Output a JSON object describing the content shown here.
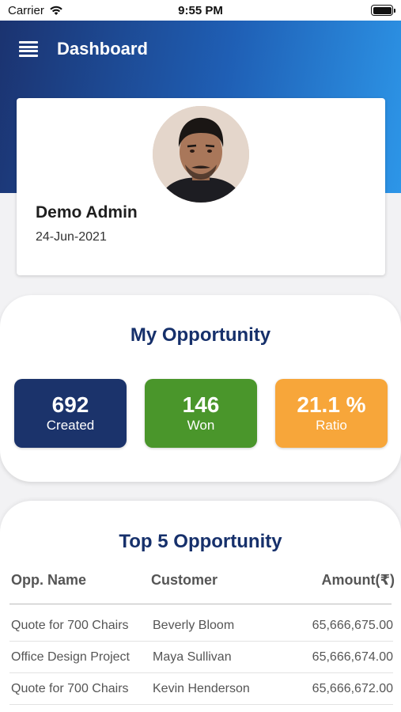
{
  "status_bar": {
    "carrier": "Carrier",
    "time": "9:55 PM",
    "wifi_icon": "wifi-icon",
    "battery_icon": "battery-icon"
  },
  "header": {
    "title": "Dashboard",
    "menu_icon": "hamburger-menu-icon"
  },
  "profile": {
    "name": "Demo Admin",
    "date": "24-Jun-2021",
    "avatar_icon": "avatar"
  },
  "my_opportunity": {
    "title": "My Opportunity",
    "stats": [
      {
        "value": "692",
        "label": "Created",
        "color": "#1b336b"
      },
      {
        "value": "146",
        "label": "Won",
        "color": "#4a962b"
      },
      {
        "value": "21.1 %",
        "label": "Ratio",
        "color": "#f7a63a"
      }
    ]
  },
  "top_opportunity": {
    "title": "Top 5 Opportunity",
    "columns": [
      "Opp. Name",
      "Customer",
      "Amount(₹)"
    ],
    "rows": [
      {
        "name": "Quote for 700 Chairs",
        "customer": "Beverly Bloom",
        "amount": "65,666,675.00"
      },
      {
        "name": "Office Design Project",
        "customer": "Maya Sullivan",
        "amount": "65,666,674.00"
      },
      {
        "name": "Quote for 700 Chairs",
        "customer": "Kevin Henderson",
        "amount": "65,666,672.00"
      }
    ]
  },
  "colors": {
    "brand_dark": "#1b3370",
    "brand_light": "#2d96e8",
    "title_navy": "#16306b"
  }
}
